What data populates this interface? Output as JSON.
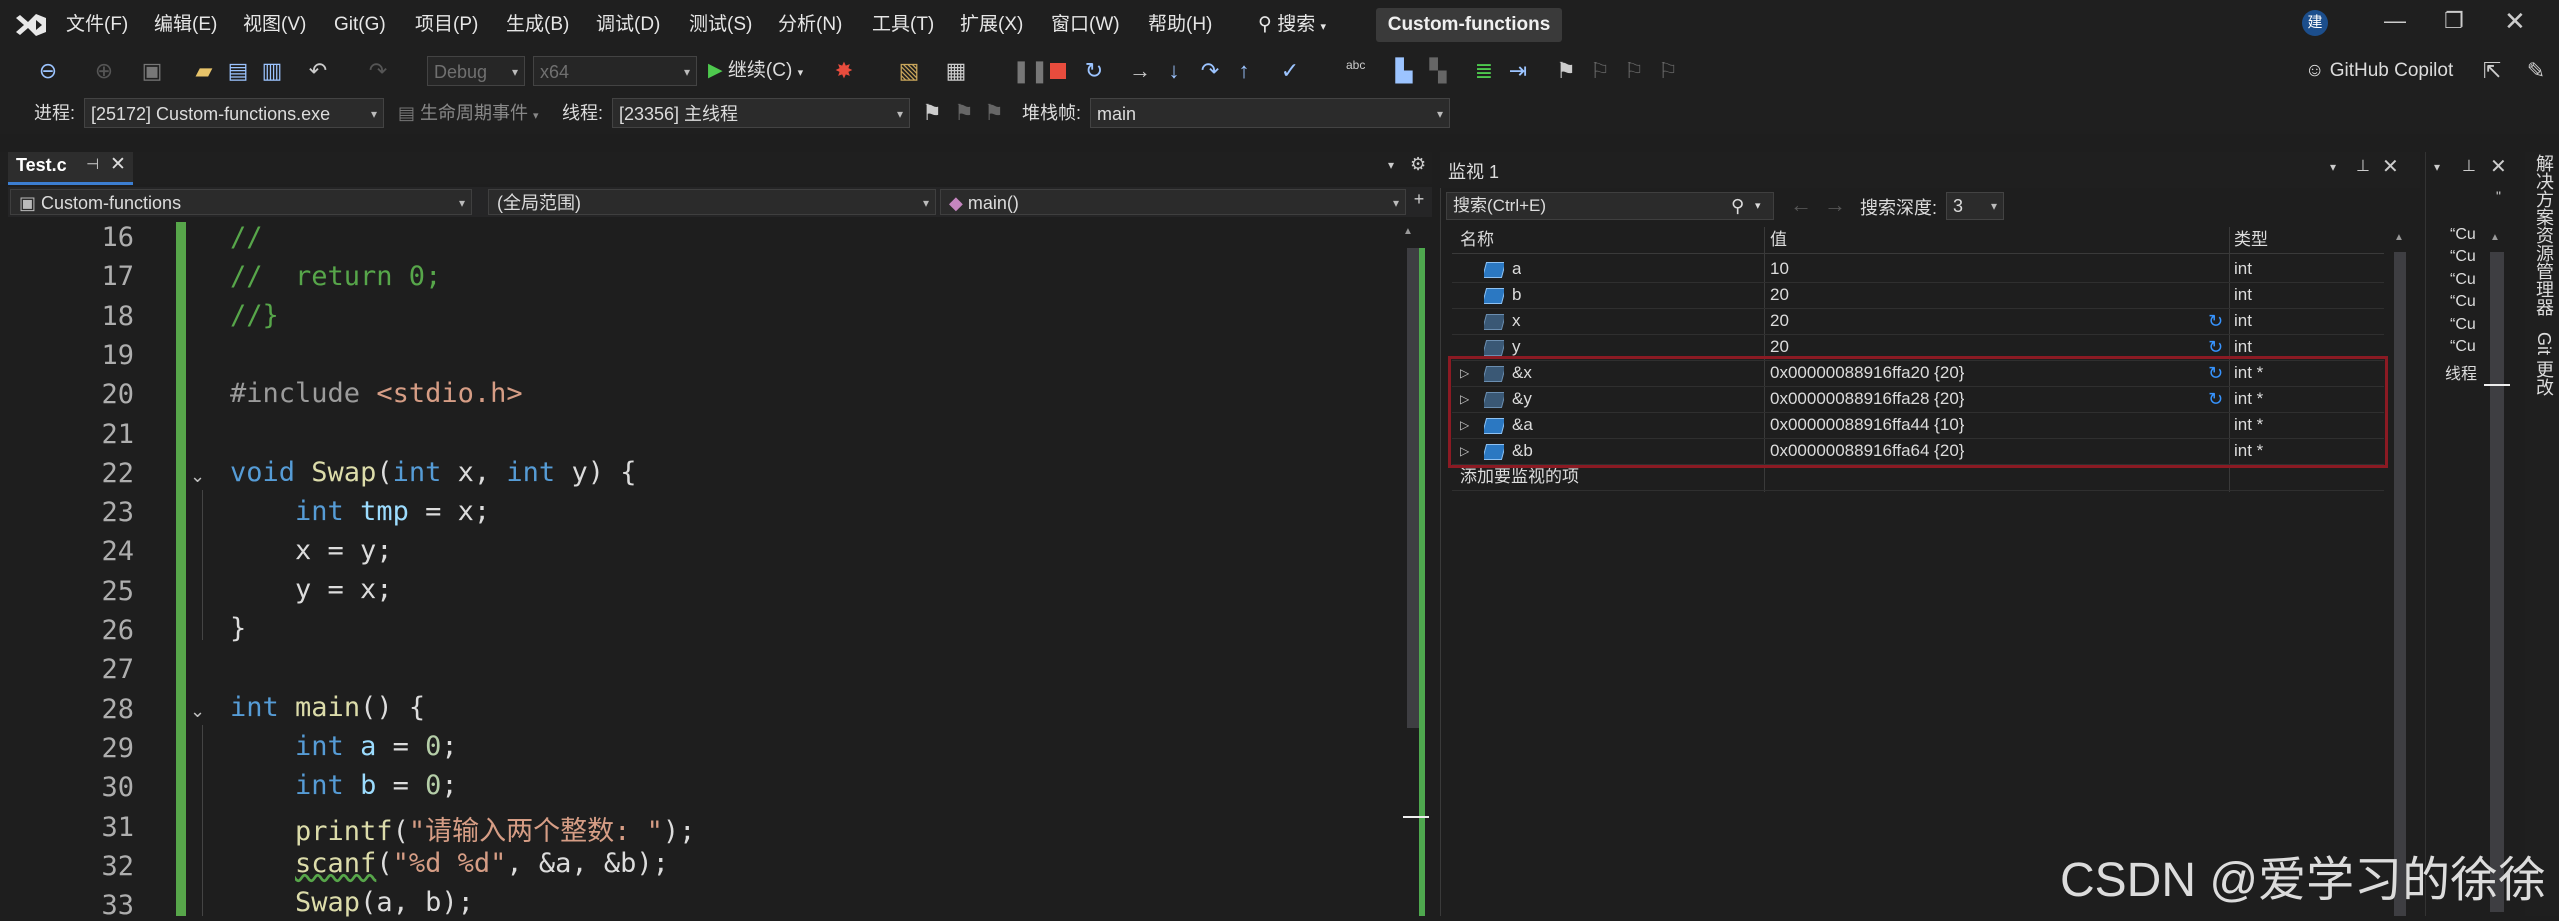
{
  "titlebar": {
    "menus": [
      "文件(F)",
      "编辑(E)",
      "视图(V)",
      "Git(G)",
      "项目(P)",
      "生成(B)",
      "调试(D)",
      "测试(S)",
      "分析(N)",
      "工具(T)",
      "扩展(X)",
      "窗口(W)",
      "帮助(H)"
    ],
    "search_label": "搜索",
    "solution_name": "Custom-functions",
    "avatar_letter": "建"
  },
  "toolbar": {
    "config": "Debug",
    "platform": "x64",
    "continue_label": "继续(C)",
    "copilot_label": "GitHub Copilot"
  },
  "debugbar": {
    "process_label": "进程:",
    "process_value": "[25172] Custom-functions.exe",
    "lifecycle_label": "生命周期事件",
    "thread_label": "线程:",
    "thread_value": "[23356] 主线程",
    "stackframe_label": "堆栈帧:",
    "stackframe_value": "main"
  },
  "editor": {
    "tab_label": "Test.c",
    "nav_project": "Custom-functions",
    "nav_scope": "(全局范围)",
    "nav_member": "main()",
    "line_numbers": [
      "16",
      "17",
      "18",
      "19",
      "20",
      "21",
      "22",
      "23",
      "24",
      "25",
      "26",
      "27",
      "28",
      "29",
      "30",
      "31",
      "32",
      "33"
    ]
  },
  "watch": {
    "title": "监视 1",
    "search_placeholder": "搜索(Ctrl+E)",
    "depth_label": "搜索深度:",
    "depth_value": "3",
    "col_name": "名称",
    "col_value": "值",
    "col_type": "类型",
    "rows": [
      {
        "name": "a",
        "value": "10",
        "type": "int"
      },
      {
        "name": "b",
        "value": "20",
        "type": "int"
      },
      {
        "name": "x",
        "value": "20",
        "type": "int"
      },
      {
        "name": "y",
        "value": "20",
        "type": "int"
      },
      {
        "name": "&x",
        "value": "0x00000088916ffa20 {20}",
        "type": "int *"
      },
      {
        "name": "&y",
        "value": "0x00000088916ffa28 {20}",
        "type": "int *"
      },
      {
        "name": "&a",
        "value": "0x00000088916ffa44 {10}",
        "type": "int *"
      },
      {
        "name": "&b",
        "value": "0x00000088916ffa64 {20}",
        "type": "int *"
      }
    ],
    "add_item": "添加要监视的项"
  },
  "rightpanel": {
    "items": [
      "“Cu",
      "“Cu",
      "“Cu",
      "“Cu",
      "“Cu",
      "“Cu"
    ],
    "thread_label": "线程",
    "sidetab1": "解决方案资源管理器",
    "sidetab2": "Git 更改"
  },
  "watermark": "CSDN @爱学习的徐徐"
}
